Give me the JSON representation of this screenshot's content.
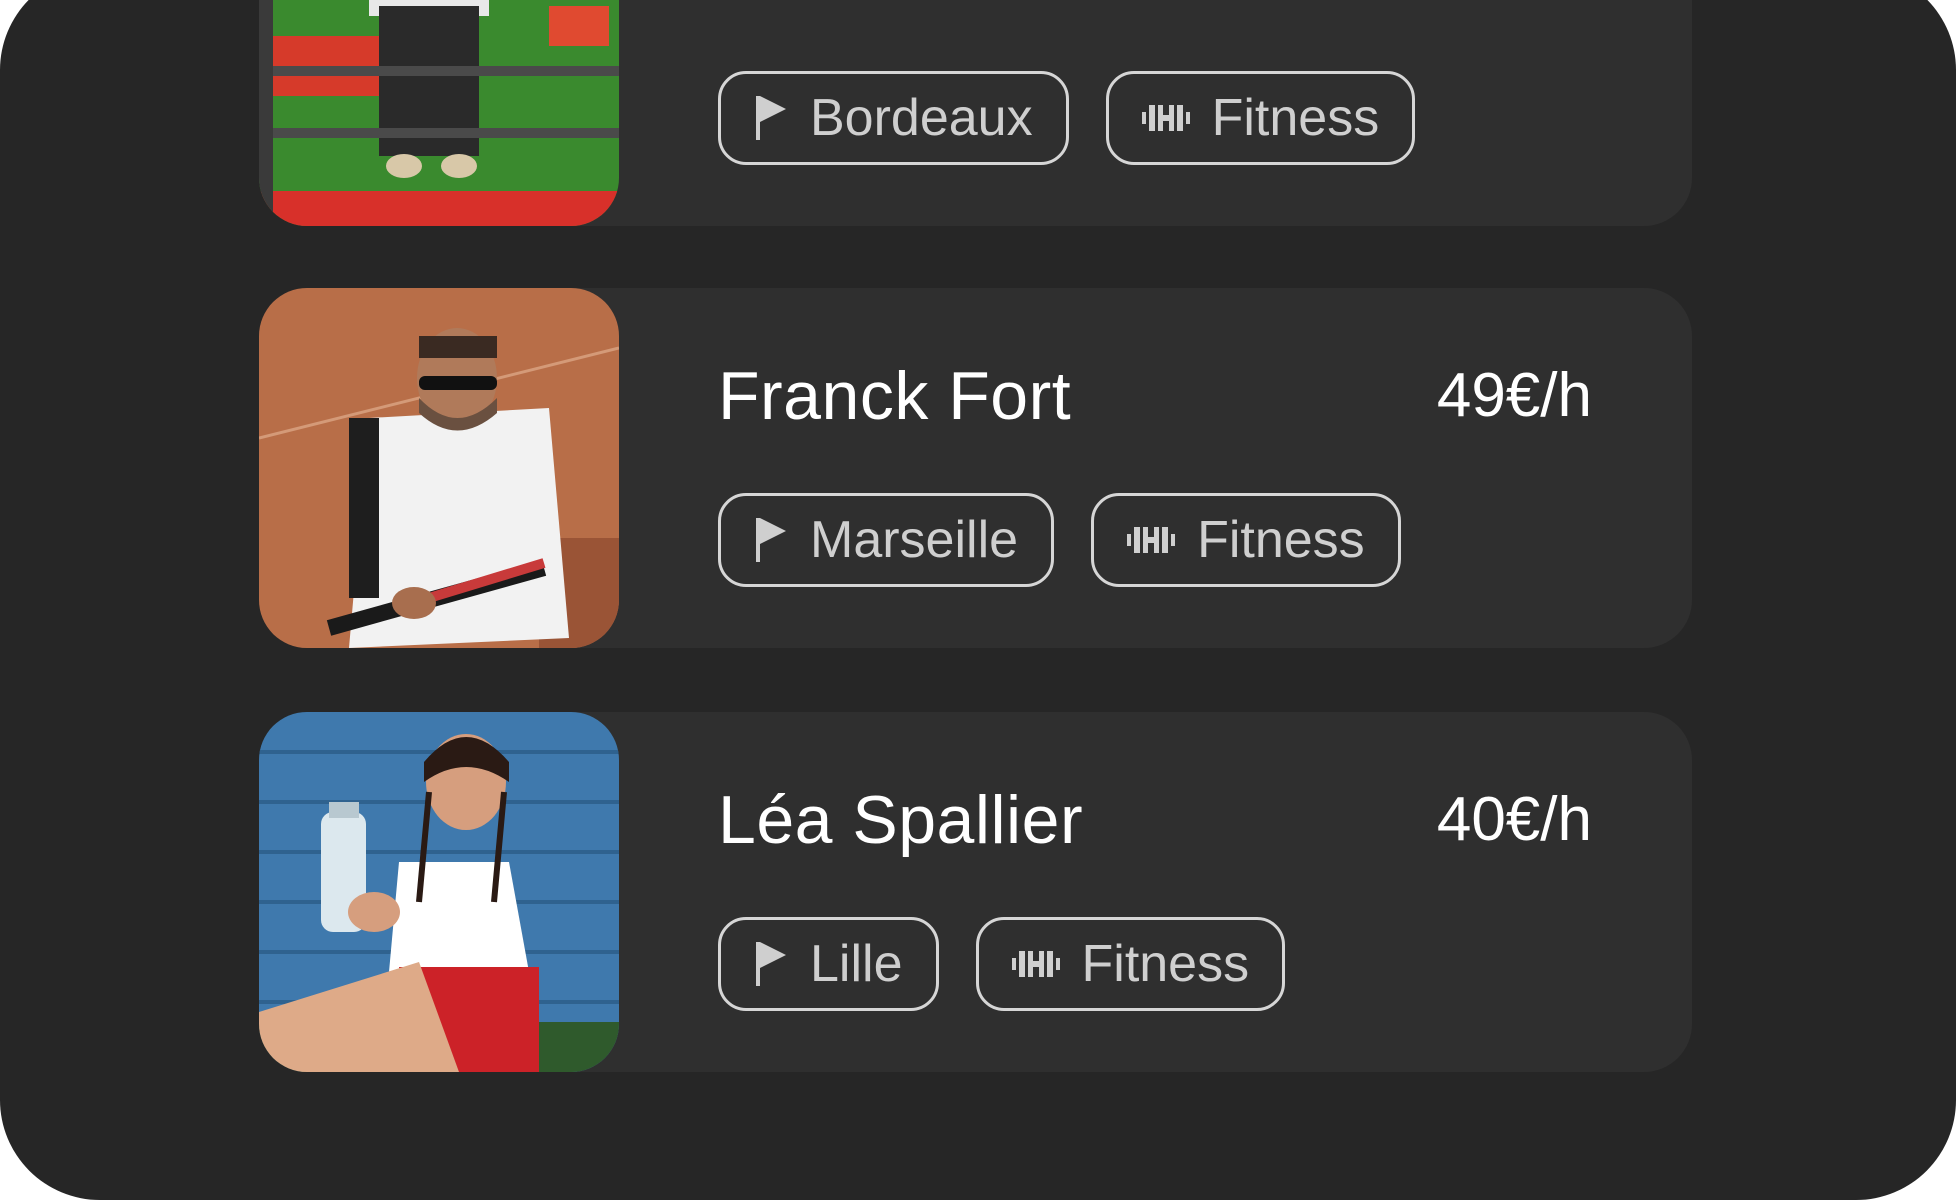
{
  "coaches": [
    {
      "name": "",
      "price": "",
      "location": "Bordeaux",
      "sport": "Fitness",
      "location_icon": "flag-icon",
      "sport_icon": "dumbbell-icon"
    },
    {
      "name": "Franck Fort",
      "price": "49€/h",
      "location": "Marseille",
      "sport": "Fitness",
      "location_icon": "flag-icon",
      "sport_icon": "dumbbell-icon"
    },
    {
      "name": "Léa Spallier",
      "price": "40€/h",
      "location": "Lille",
      "sport": "Fitness",
      "location_icon": "flag-icon",
      "sport_icon": "dumbbell-icon"
    }
  ],
  "colors": {
    "background": "#262626",
    "card": "#2f2f2f",
    "text": "#ffffff",
    "tag_border": "#d6d6d6",
    "tag_text": "#cfcfcf"
  }
}
